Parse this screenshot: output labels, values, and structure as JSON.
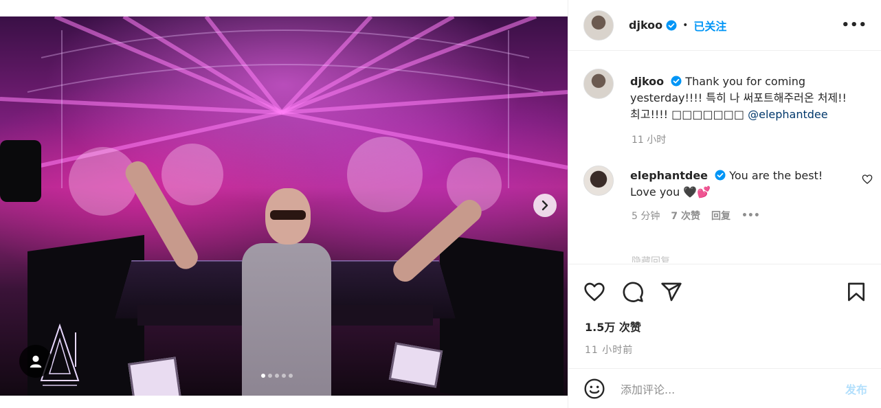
{
  "post": {
    "photo": {
      "carousel_total": 5,
      "carousel_active": 1,
      "next_icon": "chevron-right-icon",
      "tag_icon": "user-tag-icon"
    },
    "author": {
      "username": "djkoo",
      "verified": true,
      "separator": "•",
      "follow_status": "已关注",
      "more_icon": "ellipsis-icon"
    },
    "caption": {
      "username": "djkoo",
      "text": "Thank you for coming yesterday!!!! 특히 나 써포트해주러온 처제!! 최고!!!! □□□□□□□",
      "mention": "@elephantdee",
      "time": "11 小时"
    },
    "comments": [
      {
        "username": "elephantdee",
        "verified": true,
        "text": "You are the best! Love you",
        "emoji": "🖤💕",
        "time": "5 分钟",
        "likes": "7 次赞",
        "reply": "回复",
        "more": "•••"
      }
    ],
    "faded_text": "隐藏回复",
    "actions": {
      "like_icon": "heart-icon",
      "comment_icon": "comment-icon",
      "share_icon": "share-icon",
      "save_icon": "bookmark-icon"
    },
    "likes": "1.5万 次赞",
    "posted": "11 小时前",
    "add_comment": {
      "emoji_icon": "smiley-icon",
      "placeholder": "添加评论...",
      "post_label": "发布"
    },
    "colors": {
      "accent": "#0095f6",
      "post_disabled": "#b2dffc",
      "secondary_text": "#8e8e8e"
    }
  }
}
